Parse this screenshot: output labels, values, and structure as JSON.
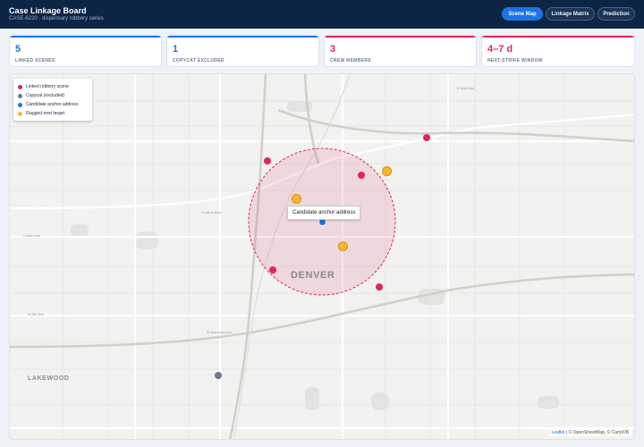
{
  "header": {
    "title": "Case Linkage Board",
    "subtitle": "CASE-6220 · dispensary robbery series",
    "nav": [
      {
        "label": "Scene Map",
        "active": true
      },
      {
        "label": "Linkage Matrix",
        "active": false
      },
      {
        "label": "Prediction",
        "active": false
      }
    ]
  },
  "kpis": [
    {
      "value": "5",
      "label": "LINKED SCENES",
      "color": "#1b73e8"
    },
    {
      "value": "1",
      "label": "COPYCAT EXCLUDED",
      "color": "#1b73e8"
    },
    {
      "value": "3",
      "label": "CREW MEMBERS",
      "color": "#e2245c"
    },
    {
      "value": "4–7 d",
      "label": "NEXT-STRIKE WINDOW",
      "color": "#e2245c"
    }
  ],
  "legend": [
    {
      "label": "Linked robbery scene",
      "color": "#e2245c"
    },
    {
      "label": "Copycat (excluded)",
      "color": "#6b7a8d"
    },
    {
      "label": "Candidate anchor address",
      "color": "#1b73e8"
    },
    {
      "label": "Flagged next target",
      "color": "#f5b931"
    }
  ],
  "map": {
    "tooltip": "Candidate anchor address",
    "city_label": "DENVER",
    "area_label": "LAKEWOOD",
    "street_labels": [
      "Colfax Ave",
      "W 6th Ave",
      "W Alameda Ave",
      "E 40th Ave",
      "Federal Blvd"
    ],
    "attribution": {
      "leaflet": "Leaflet",
      "rest": " | © OpenStreetMap, © CartoDB"
    }
  }
}
